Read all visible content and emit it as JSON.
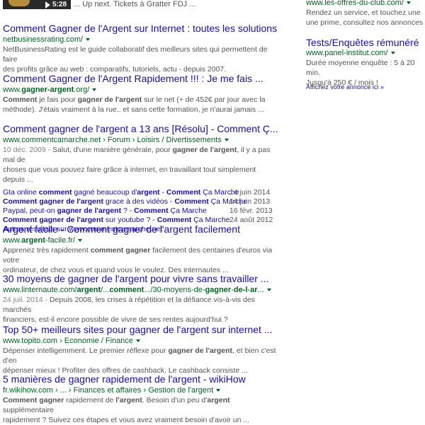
{
  "top": {
    "thumb_duration": "5:28",
    "upnext": "... Up next. Tickets à Gratter FDJ ..."
  },
  "results": [
    {
      "title": "Comment Gagner de l'Argent sur Internet : toutes les solutions",
      "url": "netbusinessrating.com/",
      "snippet": [
        "NetBusinessRating est le guide collaboratif des meilleurs sites qui permettent de faire",
        "des profits grâce au web : comparatifs, tutoriels, actu - depuis 2007."
      ]
    },
    {
      "title": "Comment Gagner de l'Argent Rapidement !!! : Je me fais ...",
      "url_pre": "www.",
      "url_bold": "gagner-argent",
      "url_post": ".org/",
      "snippet_html": [
        "<b>Comment</b> je fais pour <b>gagner de l'argent</b> sur le net (+ de 452€ par jour avec la",
        "méthode). J'étais vraiment à la rue.. et sans cette formation, je n'aurai jamais ..."
      ]
    },
    {
      "title": "Comment gagner de l'argent a 13 ans [Résolu] - Comment Ç...",
      "url": "www.commentcamarche.net › Forum › Loisirs / Divertissements",
      "snippet_html": [
        "<span class=\"d\">10 déc. 2009 - </span>Salut, d'une manière générale, pour <b>gagner de l'argent</b>, il y a pas mal de",
        "choses que vous pouvez faire grâce à internet, en travaillant tout simplement depuis ..."
      ],
      "subs": [
        {
          "text_html": "Gta online <b>comment</b> gagné beaucoup d'<b>argent</b> - <b>Comment</b> Ça Marche",
          "date": "14 juin 2014"
        },
        {
          "text_html": "<b>Comment gagner de l'argent</b> grace à des vidéos - <b>Comment</b> Ça Marche",
          "date": "14 juin 2013"
        },
        {
          "text_html": "Paypal, peut-on <b>gagner de l'argent</b> ? - <b>Comment</b> Ça Marche",
          "date": "16 févr. 2013"
        },
        {
          "text_html": "<b>Comment gagner de l'argent</b> sur youtube ? - <b>Comment</b> Ça Marche",
          "date": "24 août 2012"
        }
      ],
      "more": "Autres résultats sur www.commentcamarche.net"
    },
    {
      "title": "Argent facile - Comment gagner de l'argent facilement",
      "url_pre": "www.",
      "url_bold": "argent",
      "url_post": "-facile.fr/",
      "snippet_html": [
        "Apprenez très rapidement <b>comment gagner</b> facilement des centaines d'euros via votre",
        "ordinateur, de chez vous et quand vous le voulez. Des internautes ..."
      ]
    },
    {
      "title": "30 moyens de gagner de l'argent pour vivre sans travailler ...",
      "url_html": "www.linternaute.com/<b>argent</b>/...<b>comment</b>.../30-moyens-de-<b>gagner</b>-<b>de-l</b>-<b>ar</b>...",
      "snippet_html": [
        "<span class=\"d\">24 juil. 2014 - </span>Depuis 2008, les crises à répétition et la défiance vis-à-vis des marchés",
        "financiers, est-il encore possible de vivre de ses rentes aujourd'hui ?"
      ]
    },
    {
      "title": "Top 50+ meilleurs sites pour gagner de l'argent sur internet ...",
      "url": "www.topito.com › Economie / Finance",
      "snippet_html": [
        "Dépenser intelligemment. Le premier réflexe pour <b>gagner de l'argent</b>, et bien c'est d'en",
        "dépenser mieux ! Profiter des offres de cashback. Le cashback consiste ..."
      ]
    },
    {
      "title": "5 manières de gagner rapidement de l'argent - wikiHow",
      "url": "fr.wikihow.com › ... › Finances et affaires › Gestion de l'argent",
      "snippet_html": [
        "<b>Comment gagner</b> rapidement de <b>l'argent</b>. Besoin d'un peu d'<b>argent</b> supplémentaire",
        "rapidement ? Suivez ces étapes et vous avez vraiment besoin d'avoir un ..."
      ]
    }
  ],
  "ads": [
    {
      "url": "www.les-offres-du-club.com/",
      "text": [
        "Rendez un service, et touchez une",
        "une prime, consultez nos annonces"
      ]
    },
    {
      "title": "Tests/Enquêtes rémunéré",
      "url": "www.panel-institut.com/",
      "text": [
        "Durée moyenne enquête : 5 à 20 min.",
        "Jusqu'à 250 € / mois !"
      ]
    }
  ],
  "ad_link": "Affichez votre annonce ici »"
}
